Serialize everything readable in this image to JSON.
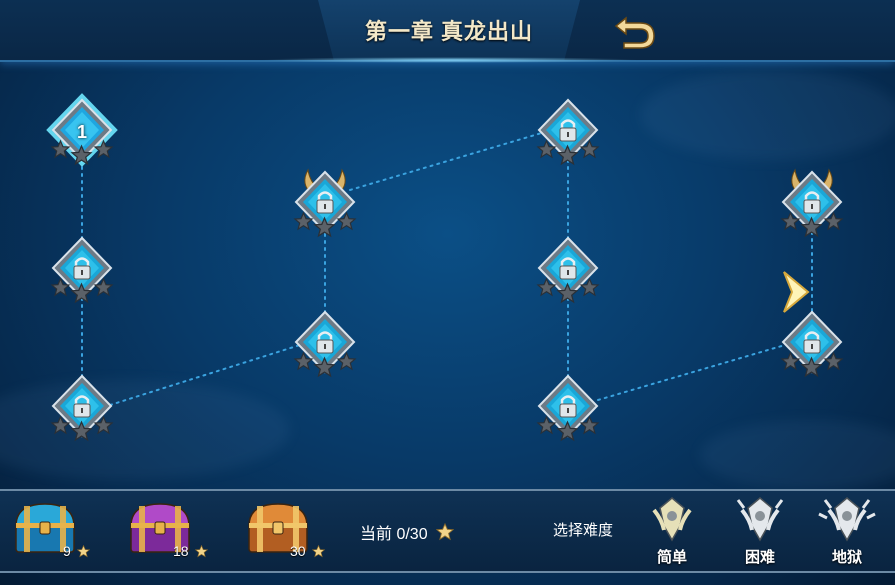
{
  "header": {
    "title": "第一章 真龙出山",
    "back_icon": "back-arrow-icon"
  },
  "levels": [
    {
      "id": "level-1",
      "label": "1",
      "state": "unlocked",
      "stars": 0
    },
    {
      "id": "level-2",
      "state": "locked",
      "stars": 0
    },
    {
      "id": "level-3",
      "state": "locked",
      "stars": 0
    },
    {
      "id": "level-4",
      "state": "locked",
      "stars": 0
    },
    {
      "id": "level-5",
      "state": "locked-boss",
      "stars": 0
    },
    {
      "id": "level-6",
      "state": "locked",
      "stars": 0
    },
    {
      "id": "level-7",
      "state": "locked",
      "stars": 0
    },
    {
      "id": "level-8",
      "state": "locked",
      "stars": 0
    },
    {
      "id": "level-9",
      "state": "locked",
      "stars": 0
    },
    {
      "id": "level-10",
      "state": "locked-boss",
      "stars": 0
    }
  ],
  "chests": [
    {
      "type": "blue",
      "count": "9"
    },
    {
      "type": "purple",
      "count": "18"
    },
    {
      "type": "gold",
      "count": "30"
    }
  ],
  "progress": {
    "text": "当前 0/30"
  },
  "difficulty": {
    "label": "选择难度",
    "options": [
      {
        "label": "简单"
      },
      {
        "label": "困难"
      },
      {
        "label": "地狱"
      }
    ]
  },
  "colors": {
    "accent": "#29c6f0",
    "gold": "#f0c87a",
    "bar": "#0a2440"
  }
}
